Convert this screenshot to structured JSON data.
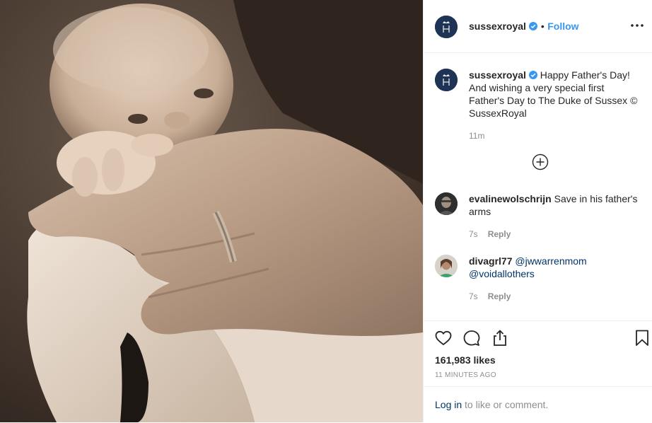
{
  "post": {
    "author": "sussexroyal",
    "dot": "•",
    "follow_label": "Follow",
    "more_icon": "more-horizontal-icon"
  },
  "caption": {
    "author": "sussexroyal",
    "text": "Happy Father's Day! And wishing a very special first Father's Day to The Duke of Sussex © SussexRoyal",
    "time": "11m"
  },
  "load_more_icon": "plus-circle-icon",
  "comments": [
    {
      "author": "evalinewolschrijn",
      "text": "Save in his father's arms",
      "time": "7s",
      "reply_label": "Reply"
    },
    {
      "author": "divagrl77",
      "mention1": "@jwwarrenmom",
      "mention2": "@voidallothers",
      "time": "7s",
      "reply_label": "Reply"
    }
  ],
  "actions": {
    "like_icon": "heart-icon",
    "comment_icon": "comment-icon",
    "share_icon": "share-icon",
    "save_icon": "bookmark-icon",
    "likes": "161,983 likes",
    "timestamp": "11 MINUTES AGO"
  },
  "login": {
    "link": "Log in",
    "rest": " to like or comment."
  },
  "colors": {
    "accent": "#3897f0",
    "link": "#003569",
    "muted": "#8e8e8e",
    "avatar_bg": "#1f3356"
  }
}
